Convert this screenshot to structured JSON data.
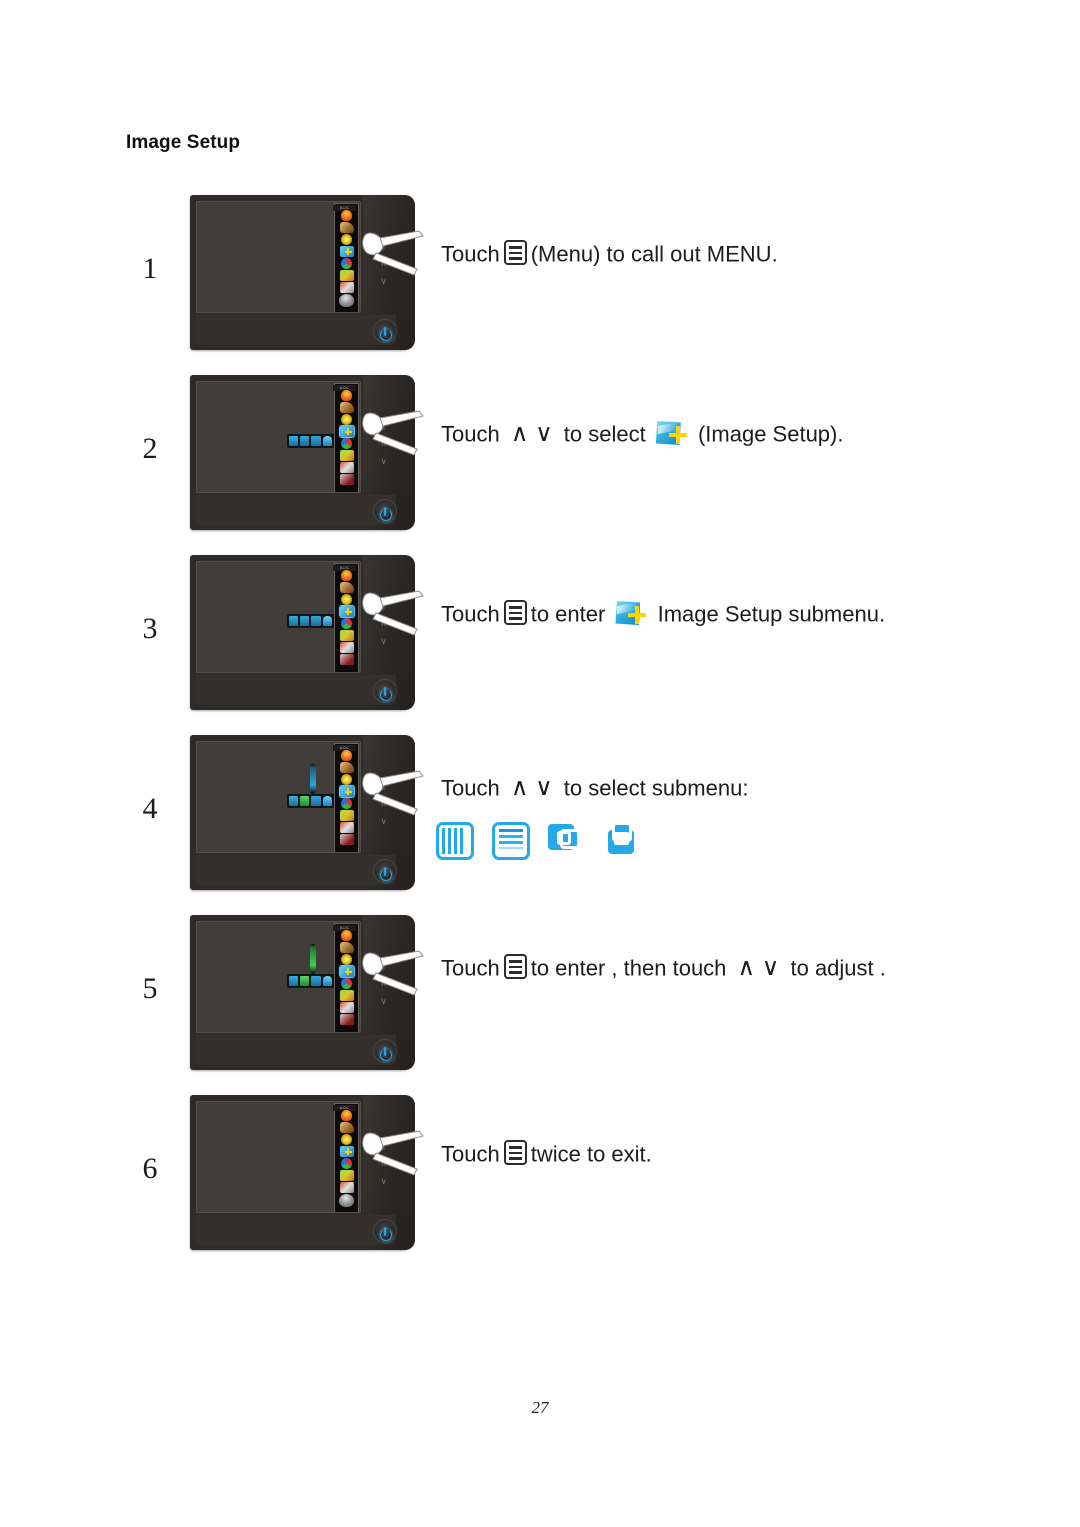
{
  "document": {
    "title": "Image Setup",
    "page_number": "27"
  },
  "steps": [
    {
      "number": "1",
      "text_before": "Touch",
      "text_after": "(Menu) to  call out MENU.",
      "icons": [
        "menu-icon"
      ],
      "monitor": {
        "osd_open": true,
        "submenu_row_visible": false,
        "slider_visible": false,
        "selected_main_index": -1
      }
    },
    {
      "number": "2",
      "text_before": "Touch",
      "chevrons": "∧ ∨",
      "text_mid": "to select",
      "text_after": "(Image Setup).",
      "icons": [
        "chevron-up-icon",
        "chevron-down-icon",
        "image-setup-icon"
      ],
      "monitor": {
        "osd_open": true,
        "submenu_row_visible": true,
        "slider_visible": false,
        "selected_main_index": 3
      }
    },
    {
      "number": "3",
      "text_before": "Touch",
      "text_mid": "to enter",
      "text_after": "Image Setup  submenu.",
      "icons": [
        "menu-icon",
        "image-setup-icon"
      ],
      "monitor": {
        "osd_open": true,
        "submenu_row_visible": true,
        "slider_visible": false,
        "selected_main_index": 3
      }
    },
    {
      "number": "4",
      "text_before": "Touch",
      "chevrons": "∧ ∨",
      "text_after": "to select submenu:",
      "icons": [
        "chevron-up-icon",
        "chevron-down-icon"
      ],
      "monitor": {
        "osd_open": true,
        "submenu_row_visible": true,
        "slider_visible": true,
        "slider_color": "blue",
        "selected_main_index": 3,
        "selected_sub_index": 1
      }
    },
    {
      "number": "5",
      "text_before": "Touch",
      "text_mid": "to enter ,  then touch",
      "chevrons": "∧ ∨",
      "text_after": "to  adjust .",
      "icons": [
        "menu-icon",
        "chevron-up-icon",
        "chevron-down-icon"
      ],
      "monitor": {
        "osd_open": true,
        "submenu_row_visible": true,
        "slider_visible": true,
        "slider_color": "green",
        "selected_main_index": 3,
        "selected_sub_index": 1
      }
    },
    {
      "number": "6",
      "text_before": "Touch",
      "text_after": "twice to exit.",
      "icons": [
        "menu-icon"
      ],
      "monitor": {
        "osd_open": true,
        "submenu_row_visible": false,
        "slider_visible": false,
        "selected_main_index": -1
      }
    }
  ],
  "submenu_icons": [
    {
      "name": "clock-icon",
      "label": "Clock"
    },
    {
      "name": "phase-icon",
      "label": "Phase"
    },
    {
      "name": "h-position-icon",
      "label": "H. Position"
    },
    {
      "name": "v-position-icon",
      "label": "V. Position"
    }
  ],
  "osd_main_items": [
    {
      "name": "luminance-icon",
      "label": "Luminance"
    },
    {
      "name": "image-boost-icon",
      "label": "Image Boost"
    },
    {
      "name": "color-setup-icon",
      "label": "Color Setup"
    },
    {
      "name": "image-setup-icon",
      "label": "Image Setup"
    },
    {
      "name": "picture-boost-icon",
      "label": "Picture Boost"
    },
    {
      "name": "osd-setup-icon",
      "label": "OSD Setup"
    },
    {
      "name": "extra-icon",
      "label": "Extra"
    },
    {
      "name": "exit-icon",
      "label": "Exit"
    }
  ],
  "monitor_controls": {
    "menu_button": "menu-touch-button",
    "up_arrow": "∧",
    "down_arrow": "∨",
    "power_button": "power-button",
    "brand": "AOC"
  },
  "colors": {
    "accent_blue": "#24a8ea",
    "accent_green": "#3fcf55",
    "accent_yellow": "#ffd400",
    "text": "#1c1c1c",
    "monitor_body": "#2e2b28",
    "monitor_screen": "#413d39"
  }
}
